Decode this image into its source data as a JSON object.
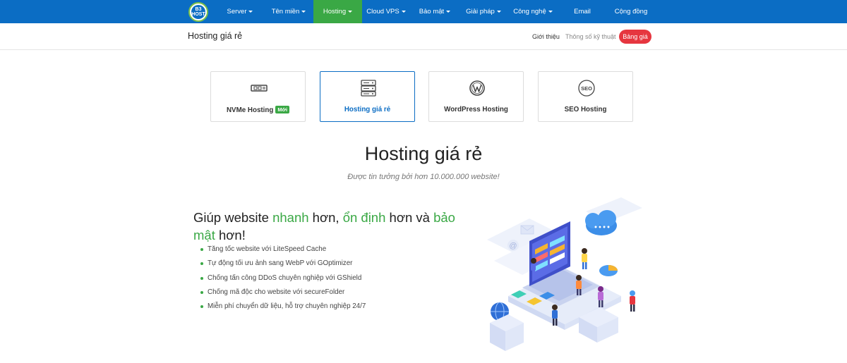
{
  "logo": {
    "text": "B3 HOST"
  },
  "nav": {
    "items": [
      {
        "label": "Server",
        "caret": true
      },
      {
        "label": "Tên miền",
        "caret": true
      },
      {
        "label": "Hosting",
        "caret": true,
        "active": true
      },
      {
        "label": "Cloud VPS",
        "caret": true
      },
      {
        "label": "Bảo mật",
        "caret": true
      },
      {
        "label": "Giải pháp",
        "caret": true
      },
      {
        "label": "Công nghệ",
        "caret": true
      },
      {
        "label": "Email",
        "caret": false
      },
      {
        "label": "Cộng đồng",
        "caret": false
      }
    ]
  },
  "subheader": {
    "title": "Hosting giá rẻ",
    "links": [
      "Giới thiệu",
      "Thông số kỹ thuật"
    ],
    "price_button": "Bảng giá"
  },
  "cards": [
    {
      "label": "NVMe Hosting",
      "badge": "Mới",
      "icon": "nvme-drive-icon"
    },
    {
      "label": "Hosting giá rẻ",
      "icon": "server-rack-icon",
      "active": true
    },
    {
      "label": "WordPress Hosting",
      "icon": "wordpress-icon"
    },
    {
      "label": "SEO Hosting",
      "icon": "seo-icon"
    }
  ],
  "seo_icon_text": "SEO",
  "hero": {
    "title": "Hosting giá rẻ",
    "subtitle": "Được tin tưởng bởi hơn 10.000.000 website!"
  },
  "headline": {
    "p1": "Giúp website ",
    "h1": "nhanh",
    "p2": " hơn, ",
    "h2": "ổn định",
    "p3": " hơn và ",
    "h3": "bảo mật",
    "p4": " hơn!"
  },
  "features": [
    "Tăng tốc website với LiteSpeed Cache",
    "Tự động tối ưu ảnh sang WebP với GOptimizer",
    "Chống tấn công DDoS chuyên nghiệp với GShield",
    "Chống mã độc cho website với secureFolder",
    "Miễn phí chuyển dữ liệu, hỗ trợ chuyên nghiệp 24/7"
  ],
  "colors": {
    "primary": "#0b6dc4",
    "accent": "#3aa845",
    "danger": "#e6363f"
  }
}
